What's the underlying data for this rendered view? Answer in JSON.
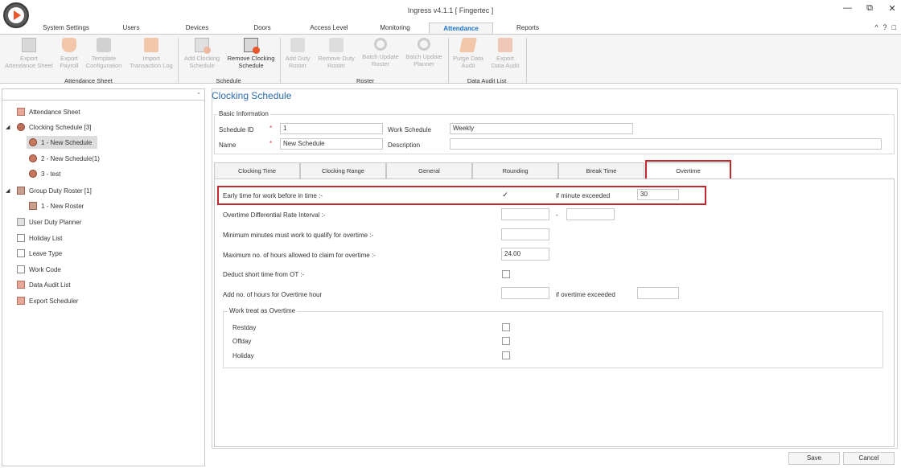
{
  "window": {
    "title": "Ingress v4.1.1 [ Fingertec ]",
    "controls": [
      "—",
      "⧉",
      "✕"
    ],
    "right_icons": [
      "^",
      "?",
      "□"
    ]
  },
  "menu_tabs": [
    "System Settings",
    "Users",
    "Devices",
    "Doors",
    "Access Level",
    "Monitoring",
    "Attendance",
    "Reports"
  ],
  "active_menu_tab": "Attendance",
  "ribbon": {
    "buttons": [
      {
        "line1": "Export",
        "line2": "Attendance Sheet",
        "enabled": false,
        "icon": "sheet-icon"
      },
      {
        "line1": "Export",
        "line2": "Payroll",
        "enabled": false,
        "icon": "money-bag-icon"
      },
      {
        "line1": "Template",
        "line2": "Configuration",
        "enabled": false,
        "icon": "tools-icon"
      },
      {
        "line1": "Import",
        "line2": "Transaction Log",
        "enabled": false,
        "icon": "import-log-icon"
      },
      {
        "line1": "Add Clocking",
        "line2": "Schedule",
        "enabled": false,
        "icon": "add-schedule-icon"
      },
      {
        "line1": "Remove Clocking",
        "line2": "Schedule",
        "enabled": true,
        "icon": "remove-schedule-icon"
      },
      {
        "line1": "Add Duty",
        "line2": "Roster",
        "enabled": false,
        "icon": "add-roster-icon"
      },
      {
        "line1": "Remove Duty",
        "line2": "Roster",
        "enabled": false,
        "icon": "remove-roster-icon"
      },
      {
        "line1": "Batch Update",
        "line2": "Roster",
        "enabled": false,
        "icon": "sync-icon"
      },
      {
        "line1": "Batch Update",
        "line2": "Planner",
        "enabled": false,
        "icon": "sync-icon"
      },
      {
        "line1": "Purge Data",
        "line2": "Audit",
        "enabled": false,
        "icon": "broom-icon"
      },
      {
        "line1": "Export",
        "line2": "Data Audit",
        "enabled": false,
        "icon": "export-icon"
      }
    ],
    "groups": [
      "Attendance Sheet",
      "Schedule",
      "Roster",
      "Data Audit List"
    ]
  },
  "tree": [
    {
      "label": "Attendance Sheet"
    },
    {
      "label": "Clocking Schedule [3]",
      "arrow": "◢"
    },
    {
      "label": "1 - New Schedule"
    },
    {
      "label": "2 - New Schedule(1)"
    },
    {
      "label": "3 - test"
    },
    {
      "label": "Group Duty Roster [1]",
      "arrow": "◢"
    },
    {
      "label": "1 - New Roster"
    },
    {
      "label": "User Duty Planner"
    },
    {
      "label": "Holiday List"
    },
    {
      "label": "Leave Type"
    },
    {
      "label": "Work Code"
    },
    {
      "label": "Data Audit List"
    },
    {
      "label": "Export Scheduler"
    }
  ],
  "form": {
    "page_title": "Clocking Schedule",
    "basic_info_legend": "Basic Information",
    "schedule_id_label": "Schedule ID",
    "schedule_id_value": "1",
    "name_label": "Name",
    "name_value": "New Schedule",
    "required_mark": "*",
    "work_schedule_label": "Work Schedule",
    "work_schedule_value": "Weekly",
    "description_label": "Description",
    "description_value": ""
  },
  "tabs": [
    "Clocking Time",
    "Clocking Range",
    "General",
    "Rounding",
    "Break Time",
    "Overtime"
  ],
  "active_tab": "Overtime",
  "overtime": {
    "early_time_label": "Early time for work before in time :-",
    "early_time_checked": "✓",
    "if_minute_exceeded_label": "if minute exceeded",
    "if_minute_exceeded_value": "30",
    "differential_label": "Overtime Differential Rate Interval :-",
    "differential_from": "",
    "differential_dash": "-",
    "differential_to": "",
    "min_minutes_label": "Minimum minutes must work to qualify for overtime :-",
    "min_minutes_value": "",
    "max_hours_label": "Maximum no. of hours allowed to claim for overtime :-",
    "max_hours_value": "24.00",
    "deduct_label": "Deduct short time from OT :-",
    "add_hours_label": "Add no. of hours for Overtime hour",
    "add_hours_value": "",
    "if_overtime_exceeded_label": "if overtime exceeded",
    "if_overtime_exceeded_value": "",
    "work_treat_legend": "Work treat as Overtime",
    "restday_label": "Restday",
    "offday_label": "Offday",
    "holiday_label": "Holiday"
  },
  "footer": {
    "save_label": "Save",
    "cancel_label": "Cancel"
  },
  "colors": {
    "accent_blue": "#1a73c8",
    "title_blue": "#2b6cb0",
    "highlight_red": "#c0282e",
    "required_red": "#d03030"
  }
}
